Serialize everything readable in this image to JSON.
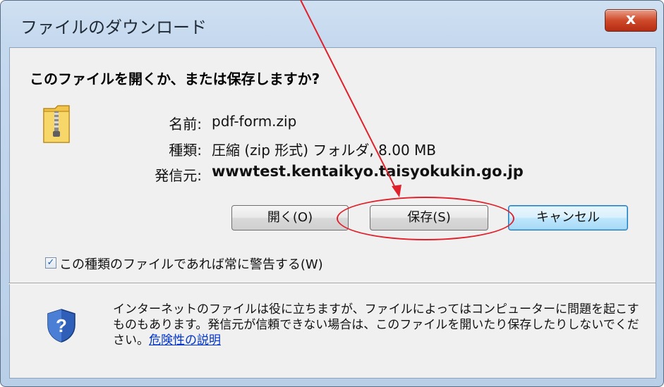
{
  "window": {
    "title": "ファイルのダウンロード",
    "close_label": "x"
  },
  "dialog": {
    "heading": "このファイルを開くか、または保存しますか?",
    "file_icon": "zip-folder-icon",
    "fields": {
      "name_label": "名前:",
      "name_value": "pdf-form.zip",
      "type_label": "種類:",
      "type_value": "圧縮 (zip 形式) フォルダ, 8.00 MB",
      "source_label": "発信元:",
      "source_value": "wwwtest.kentaikyo.taisyokukin.go.jp"
    },
    "buttons": {
      "open": "開く(O)",
      "save": "保存(S)",
      "cancel": "キャンセル"
    },
    "checkbox": {
      "checked": true,
      "label": "この種類のファイルであれば常に警告する(W)"
    },
    "warning": {
      "icon": "shield-question-icon",
      "text": "インターネットのファイルは役に立ちますが、ファイルによってはコンピューターに問題を起こすものもあります。発信元が信頼できない場合は、このファイルを開いたり保存したりしないでください。",
      "link": "危険性の説明"
    }
  },
  "annotation": {
    "color": "#e0202a"
  }
}
